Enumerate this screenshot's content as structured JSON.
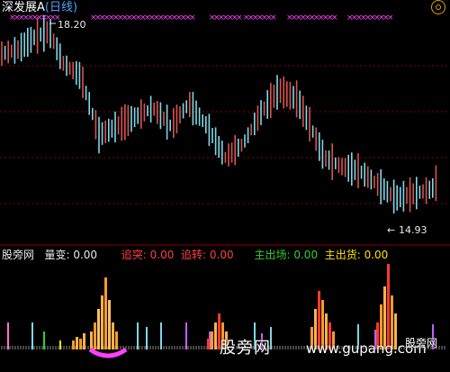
{
  "window": {
    "stock_name": "深发展A",
    "period": "(日线)"
  },
  "price_panel": {
    "high_label": "18.20",
    "low_label": "14.93",
    "low_prefix": "←",
    "grid_color": "#8b0000",
    "up_color": "#d9534f",
    "down_color": "#7fd7e8",
    "signal_marker": "×",
    "signal_color": "#ff40ff"
  },
  "indicator_header": {
    "title": "股旁网",
    "items": [
      {
        "label": "量变:",
        "value": "0.00",
        "color": "#e8e8e8"
      },
      {
        "label": "追突:",
        "value": "0.00",
        "color": "#ff4040"
      },
      {
        "label": "追转:",
        "value": "0.00",
        "color": "#ff4040"
      },
      {
        "label": "主出场:",
        "value": "0.00",
        "color": "#30d030"
      },
      {
        "label": "主出货:",
        "value": "0.00",
        "color": "#ffe000"
      }
    ]
  },
  "watermark": {
    "site_name": "股旁网",
    "url": "www.gupang.com",
    "brand": "股旁网"
  }
}
